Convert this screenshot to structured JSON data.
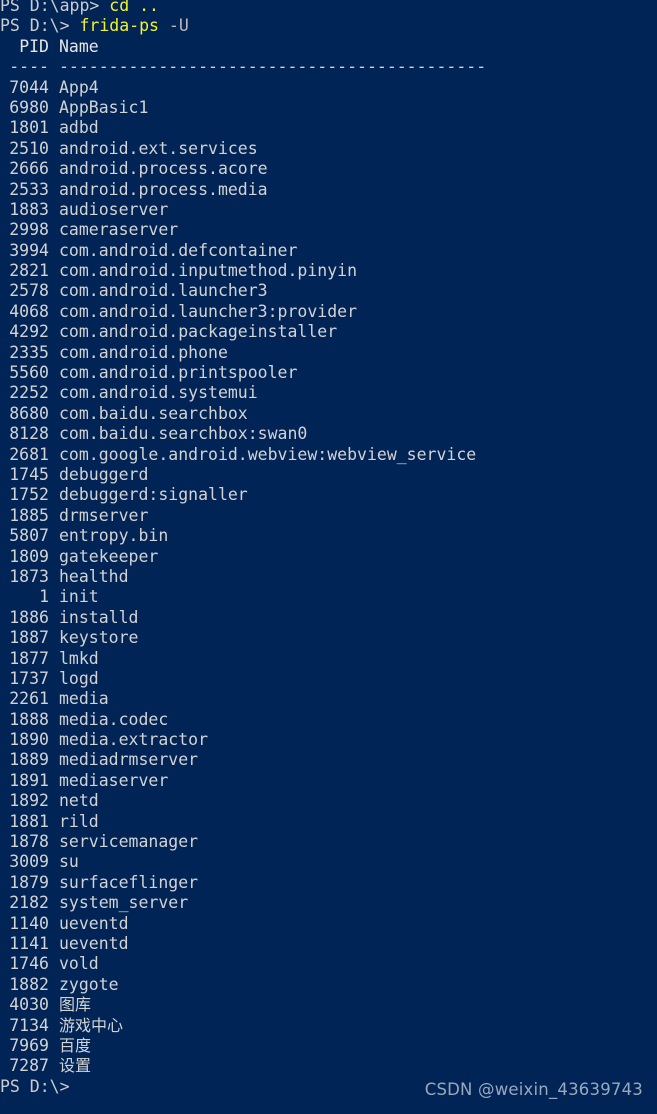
{
  "terminal": {
    "shell": "PowerShell",
    "background_color": "#012456",
    "foreground_color": "#cccccc",
    "command_color": "#f3f32a",
    "argument_color": "#b9b9b9",
    "watermark_color": "#9aa8bd"
  },
  "session": {
    "line1": {
      "prompt": "PS D:\\app> ",
      "command": "cd",
      "args": " .."
    },
    "line2": {
      "prompt": "PS D:\\> ",
      "command": "frida-ps",
      "args": " -U"
    },
    "trailing_prompt": "PS D:\\>"
  },
  "table": {
    "header": {
      "pid": "PID",
      "name": "Name"
    },
    "separator": {
      "pid": "----",
      "name": "-------------------------------------------"
    },
    "rows": [
      {
        "pid": "7044",
        "name": "App4"
      },
      {
        "pid": "6980",
        "name": "AppBasic1"
      },
      {
        "pid": "1801",
        "name": "adbd"
      },
      {
        "pid": "2510",
        "name": "android.ext.services"
      },
      {
        "pid": "2666",
        "name": "android.process.acore"
      },
      {
        "pid": "2533",
        "name": "android.process.media"
      },
      {
        "pid": "1883",
        "name": "audioserver"
      },
      {
        "pid": "2998",
        "name": "cameraserver"
      },
      {
        "pid": "3994",
        "name": "com.android.defcontainer"
      },
      {
        "pid": "2821",
        "name": "com.android.inputmethod.pinyin"
      },
      {
        "pid": "2578",
        "name": "com.android.launcher3"
      },
      {
        "pid": "4068",
        "name": "com.android.launcher3:provider"
      },
      {
        "pid": "4292",
        "name": "com.android.packageinstaller"
      },
      {
        "pid": "2335",
        "name": "com.android.phone"
      },
      {
        "pid": "5560",
        "name": "com.android.printspooler"
      },
      {
        "pid": "2252",
        "name": "com.android.systemui"
      },
      {
        "pid": "8680",
        "name": "com.baidu.searchbox"
      },
      {
        "pid": "8128",
        "name": "com.baidu.searchbox:swan0"
      },
      {
        "pid": "2681",
        "name": "com.google.android.webview:webview_service"
      },
      {
        "pid": "1745",
        "name": "debuggerd"
      },
      {
        "pid": "1752",
        "name": "debuggerd:signaller"
      },
      {
        "pid": "1885",
        "name": "drmserver"
      },
      {
        "pid": "5807",
        "name": "entropy.bin"
      },
      {
        "pid": "1809",
        "name": "gatekeeper"
      },
      {
        "pid": "1873",
        "name": "healthd"
      },
      {
        "pid": "1",
        "name": "init"
      },
      {
        "pid": "1886",
        "name": "installd"
      },
      {
        "pid": "1887",
        "name": "keystore"
      },
      {
        "pid": "1877",
        "name": "lmkd"
      },
      {
        "pid": "1737",
        "name": "logd"
      },
      {
        "pid": "2261",
        "name": "media"
      },
      {
        "pid": "1888",
        "name": "media.codec"
      },
      {
        "pid": "1890",
        "name": "media.extractor"
      },
      {
        "pid": "1889",
        "name": "mediadrmserver"
      },
      {
        "pid": "1891",
        "name": "mediaserver"
      },
      {
        "pid": "1892",
        "name": "netd"
      },
      {
        "pid": "1881",
        "name": "rild"
      },
      {
        "pid": "1878",
        "name": "servicemanager"
      },
      {
        "pid": "3009",
        "name": "su"
      },
      {
        "pid": "1879",
        "name": "surfaceflinger"
      },
      {
        "pid": "2182",
        "name": "system_server"
      },
      {
        "pid": "1140",
        "name": "ueventd"
      },
      {
        "pid": "1141",
        "name": "ueventd"
      },
      {
        "pid": "1746",
        "name": "vold"
      },
      {
        "pid": "1882",
        "name": "zygote"
      },
      {
        "pid": "4030",
        "name": "图库",
        "cjk": true
      },
      {
        "pid": "7134",
        "name": "游戏中心",
        "cjk": true
      },
      {
        "pid": "7969",
        "name": "百度",
        "cjk": true
      },
      {
        "pid": "7287",
        "name": "设置",
        "cjk": true
      }
    ]
  },
  "watermark": {
    "text": "CSDN @weixin_43639743"
  }
}
